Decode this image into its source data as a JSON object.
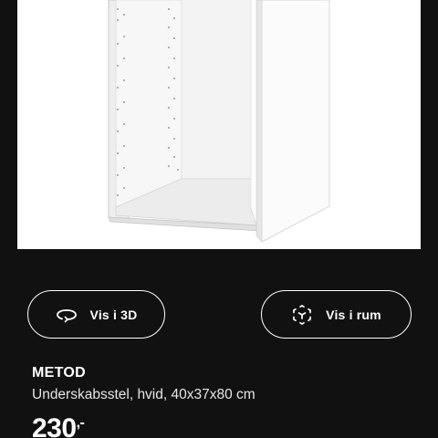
{
  "product": {
    "image_icon": "white-cabinet-frame-image",
    "name": "METOD",
    "description": "Underskabsstel, hvid, 40x37x80 cm",
    "price": "230",
    "price_suffix": ",-"
  },
  "actions": {
    "view_3d": {
      "label": "Vis i 3D",
      "icon": "rotate-3d-icon"
    },
    "view_in_room": {
      "label": "Vis i rum",
      "icon": "augmented-reality-icon"
    }
  },
  "colors": {
    "background": "#111111",
    "panel": "#ffffff",
    "text": "#ffffff"
  }
}
